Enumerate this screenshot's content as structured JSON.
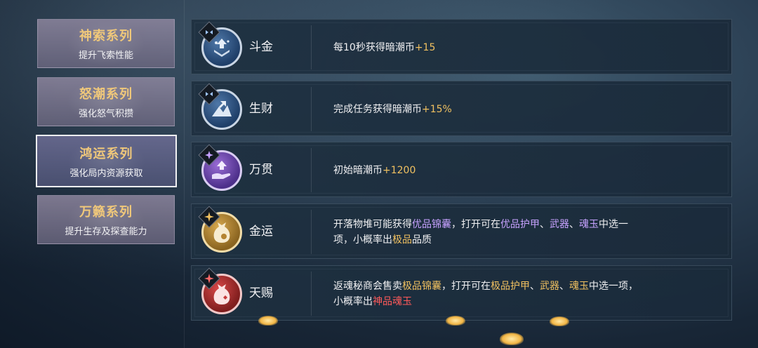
{
  "tabs": [
    {
      "title": "神索系列",
      "subtitle": "提升飞索性能",
      "active": false
    },
    {
      "title": "怒潮系列",
      "subtitle": "强化怒气积攒",
      "active": false
    },
    {
      "title": "鸿运系列",
      "subtitle": "强化局内资源获取",
      "active": true
    },
    {
      "title": "万籁系列",
      "subtitle": "提升生存及探查能力",
      "active": false
    }
  ],
  "rows": [
    {
      "name": "斗金",
      "icon": "coin-stack-icon",
      "rarity": "blue",
      "desc": [
        {
          "t": "每10秒获得暗潮币"
        },
        {
          "t": "+15",
          "c": "gold"
        }
      ]
    },
    {
      "name": "生财",
      "icon": "mountain-rise-icon",
      "rarity": "blue",
      "desc": [
        {
          "t": "完成任务获得暗潮币"
        },
        {
          "t": "+15%",
          "c": "gold"
        }
      ]
    },
    {
      "name": "万贯",
      "icon": "hand-coins-icon",
      "rarity": "purple",
      "desc": [
        {
          "t": "初始暗潮币"
        },
        {
          "t": "+1200",
          "c": "gold"
        }
      ]
    },
    {
      "name": "金运",
      "icon": "lucky-bag-icon",
      "rarity": "gold",
      "desc": [
        {
          "t": "开落物堆可能获得"
        },
        {
          "t": "优品锦囊",
          "c": "purple"
        },
        {
          "t": "，打开可在"
        },
        {
          "t": "优品护甲",
          "c": "purple"
        },
        {
          "t": "、"
        },
        {
          "t": "武器",
          "c": "purple"
        },
        {
          "t": "、"
        },
        {
          "t": "魂玉",
          "c": "purple"
        },
        {
          "t": "中选一项，小概率出"
        },
        {
          "t": "极品",
          "c": "gold"
        },
        {
          "t": "品质"
        }
      ]
    },
    {
      "name": "天赐",
      "icon": "fortune-bag-icon",
      "rarity": "red",
      "desc": [
        {
          "t": "返魂秘商会售卖"
        },
        {
          "t": "极品锦囊",
          "c": "gold"
        },
        {
          "t": "，打开可在"
        },
        {
          "t": "极品护甲",
          "c": "gold"
        },
        {
          "t": "、"
        },
        {
          "t": "武器",
          "c": "gold"
        },
        {
          "t": "、"
        },
        {
          "t": "魂玉",
          "c": "gold"
        },
        {
          "t": "中选一项，小概率出"
        },
        {
          "t": "神品魂玉",
          "c": "red"
        }
      ]
    }
  ],
  "colors": {
    "gold": "#f0c060",
    "purple": "#c7a2ff",
    "red": "#ff5a5a"
  }
}
